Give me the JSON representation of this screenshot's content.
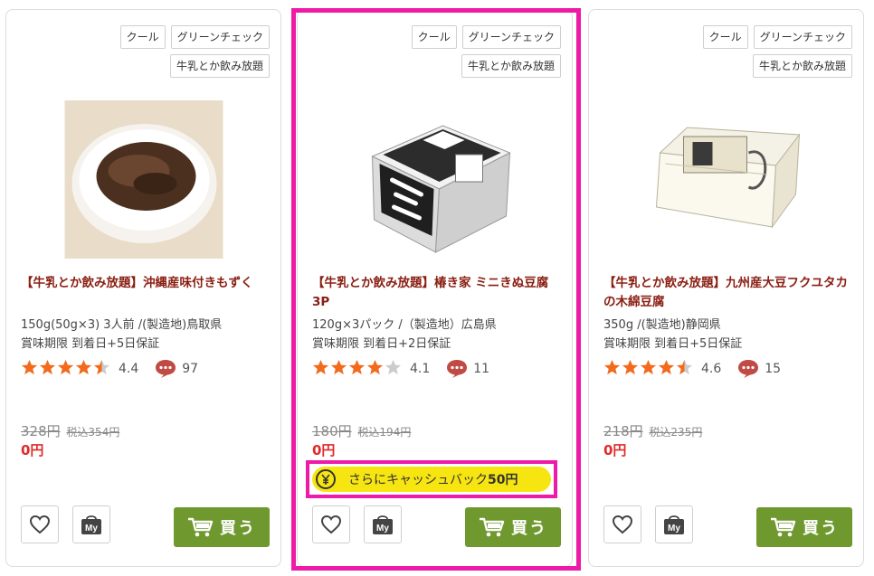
{
  "products": [
    {
      "tags": [
        "クール",
        "グリーンチェック",
        "牛乳とか飲み放題"
      ],
      "image_alt": "沖縄産味付きもずく",
      "title": "【牛乳とか飲み放題】沖縄産味付きもずく",
      "spec_line1": "150g(50g×3) 3人前 /(製造地)鳥取県",
      "spec_line2": "賞味期限 到着日+5日保証",
      "rating_value": 4.4,
      "rating_text": "4.4",
      "review_count": "97",
      "price_old": "328円",
      "price_tax": "税込354円",
      "price_now": "0円",
      "buy_label": "買う"
    },
    {
      "tags": [
        "クール",
        "グリーンチェック",
        "牛乳とか飲み放題"
      ],
      "image_alt": "椿き家 ミニきぬ豆腐",
      "title": "【牛乳とか飲み放題】椿き家 ミニきぬ豆腐　3P",
      "spec_line1": "120g×3パック /（製造地）広島県",
      "spec_line2": "賞味期限 到着日+2日保証",
      "rating_value": 4.1,
      "rating_text": "4.1",
      "review_count": "11",
      "price_old": "180円",
      "price_tax": "税込194円",
      "price_now": "0円",
      "cashback_prefix": "さらにキャッシュバック",
      "cashback_amount": "50円",
      "buy_label": "買う"
    },
    {
      "tags": [
        "クール",
        "グリーンチェック",
        "牛乳とか飲み放題"
      ],
      "image_alt": "九州産大豆フクユタカの木綿豆腐",
      "title": "【牛乳とか飲み放題】九州産大豆フクユタカの木綿豆腐",
      "spec_line1": "350g /(製造地)静岡県",
      "spec_line2": "賞味期限 到着日+5日保証",
      "rating_value": 4.6,
      "rating_text": "4.6",
      "review_count": "15",
      "price_old": "218円",
      "price_tax": "税込235円",
      "price_now": "0円",
      "buy_label": "買う"
    }
  ],
  "colors": {
    "title": "#8a1e12",
    "price_now": "#e02a2a",
    "star_on": "#f26b1d",
    "star_off": "#cccccc",
    "comment_icon": "#c04a44",
    "buy_button": "#6f992f",
    "cashback_bg": "#f7e511",
    "highlight": "#ee1aa8"
  },
  "icons": {
    "favorite": "heart-icon",
    "my_list": "my-bag-icon",
    "cart": "cart-icon",
    "comment": "comment-icon",
    "cashback": "yen-coin-icon"
  }
}
